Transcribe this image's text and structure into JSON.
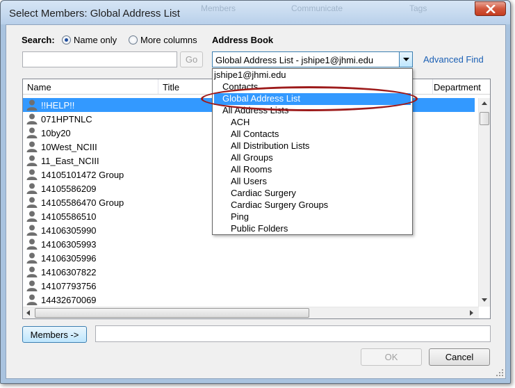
{
  "window": {
    "title": "Select Members: Global Address List",
    "background_tabs": [
      "Members",
      "Communicate",
      "Tags"
    ]
  },
  "search": {
    "label": "Search:",
    "option_name_only": "Name only",
    "option_more_columns": "More columns",
    "selected_option": "Name only",
    "input_value": "",
    "go_label": "Go"
  },
  "address_book": {
    "label": "Address Book",
    "selected": "Global Address List - jshipe1@jhmi.edu",
    "advanced_find": "Advanced Find",
    "dropdown_items": [
      "jshipe1@jhmi.edu",
      "Contacts",
      "Global Address List",
      "All Address Lists",
      "ACH",
      "All Contacts",
      "All Distribution Lists",
      "All Groups",
      "All Rooms",
      "All Users",
      "Cardiac Surgery",
      "Cardiac Surgery Groups",
      "Ping",
      "Public Folders"
    ],
    "highlighted_item": "Global Address List"
  },
  "list": {
    "columns": [
      "Name",
      "Title",
      "Department"
    ],
    "rows": [
      "!!HELP!!",
      "071HPTNLC",
      "10by20",
      "10West_NCIII",
      "11_East_NCIII",
      "14105101472 Group",
      "14105586209",
      "14105586470 Group",
      "14105586510",
      "14106305990",
      "14106305993",
      "14106305996",
      "14106307822",
      "14107793756",
      "14432670069"
    ],
    "selected_row": "!!HELP!!"
  },
  "members": {
    "button_label": "Members ->",
    "value": ""
  },
  "footer": {
    "ok_label": "OK",
    "cancel_label": "Cancel"
  },
  "colors": {
    "selection": "#3399ff",
    "annotation_oval": "#9d1b1b",
    "link": "#1a5fb4"
  }
}
